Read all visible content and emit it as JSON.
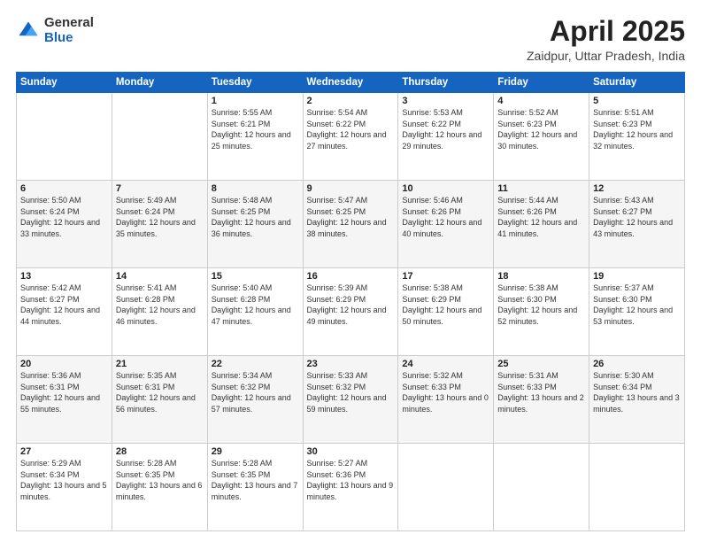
{
  "logo": {
    "general": "General",
    "blue": "Blue"
  },
  "title": "April 2025",
  "location": "Zaidpur, Uttar Pradesh, India",
  "days_of_week": [
    "Sunday",
    "Monday",
    "Tuesday",
    "Wednesday",
    "Thursday",
    "Friday",
    "Saturday"
  ],
  "weeks": [
    [
      {
        "day": "",
        "info": ""
      },
      {
        "day": "",
        "info": ""
      },
      {
        "day": "1",
        "info": "Sunrise: 5:55 AM\nSunset: 6:21 PM\nDaylight: 12 hours and 25 minutes."
      },
      {
        "day": "2",
        "info": "Sunrise: 5:54 AM\nSunset: 6:22 PM\nDaylight: 12 hours and 27 minutes."
      },
      {
        "day": "3",
        "info": "Sunrise: 5:53 AM\nSunset: 6:22 PM\nDaylight: 12 hours and 29 minutes."
      },
      {
        "day": "4",
        "info": "Sunrise: 5:52 AM\nSunset: 6:23 PM\nDaylight: 12 hours and 30 minutes."
      },
      {
        "day": "5",
        "info": "Sunrise: 5:51 AM\nSunset: 6:23 PM\nDaylight: 12 hours and 32 minutes."
      }
    ],
    [
      {
        "day": "6",
        "info": "Sunrise: 5:50 AM\nSunset: 6:24 PM\nDaylight: 12 hours and 33 minutes."
      },
      {
        "day": "7",
        "info": "Sunrise: 5:49 AM\nSunset: 6:24 PM\nDaylight: 12 hours and 35 minutes."
      },
      {
        "day": "8",
        "info": "Sunrise: 5:48 AM\nSunset: 6:25 PM\nDaylight: 12 hours and 36 minutes."
      },
      {
        "day": "9",
        "info": "Sunrise: 5:47 AM\nSunset: 6:25 PM\nDaylight: 12 hours and 38 minutes."
      },
      {
        "day": "10",
        "info": "Sunrise: 5:46 AM\nSunset: 6:26 PM\nDaylight: 12 hours and 40 minutes."
      },
      {
        "day": "11",
        "info": "Sunrise: 5:44 AM\nSunset: 6:26 PM\nDaylight: 12 hours and 41 minutes."
      },
      {
        "day": "12",
        "info": "Sunrise: 5:43 AM\nSunset: 6:27 PM\nDaylight: 12 hours and 43 minutes."
      }
    ],
    [
      {
        "day": "13",
        "info": "Sunrise: 5:42 AM\nSunset: 6:27 PM\nDaylight: 12 hours and 44 minutes."
      },
      {
        "day": "14",
        "info": "Sunrise: 5:41 AM\nSunset: 6:28 PM\nDaylight: 12 hours and 46 minutes."
      },
      {
        "day": "15",
        "info": "Sunrise: 5:40 AM\nSunset: 6:28 PM\nDaylight: 12 hours and 47 minutes."
      },
      {
        "day": "16",
        "info": "Sunrise: 5:39 AM\nSunset: 6:29 PM\nDaylight: 12 hours and 49 minutes."
      },
      {
        "day": "17",
        "info": "Sunrise: 5:38 AM\nSunset: 6:29 PM\nDaylight: 12 hours and 50 minutes."
      },
      {
        "day": "18",
        "info": "Sunrise: 5:38 AM\nSunset: 6:30 PM\nDaylight: 12 hours and 52 minutes."
      },
      {
        "day": "19",
        "info": "Sunrise: 5:37 AM\nSunset: 6:30 PM\nDaylight: 12 hours and 53 minutes."
      }
    ],
    [
      {
        "day": "20",
        "info": "Sunrise: 5:36 AM\nSunset: 6:31 PM\nDaylight: 12 hours and 55 minutes."
      },
      {
        "day": "21",
        "info": "Sunrise: 5:35 AM\nSunset: 6:31 PM\nDaylight: 12 hours and 56 minutes."
      },
      {
        "day": "22",
        "info": "Sunrise: 5:34 AM\nSunset: 6:32 PM\nDaylight: 12 hours and 57 minutes."
      },
      {
        "day": "23",
        "info": "Sunrise: 5:33 AM\nSunset: 6:32 PM\nDaylight: 12 hours and 59 minutes."
      },
      {
        "day": "24",
        "info": "Sunrise: 5:32 AM\nSunset: 6:33 PM\nDaylight: 13 hours and 0 minutes."
      },
      {
        "day": "25",
        "info": "Sunrise: 5:31 AM\nSunset: 6:33 PM\nDaylight: 13 hours and 2 minutes."
      },
      {
        "day": "26",
        "info": "Sunrise: 5:30 AM\nSunset: 6:34 PM\nDaylight: 13 hours and 3 minutes."
      }
    ],
    [
      {
        "day": "27",
        "info": "Sunrise: 5:29 AM\nSunset: 6:34 PM\nDaylight: 13 hours and 5 minutes."
      },
      {
        "day": "28",
        "info": "Sunrise: 5:28 AM\nSunset: 6:35 PM\nDaylight: 13 hours and 6 minutes."
      },
      {
        "day": "29",
        "info": "Sunrise: 5:28 AM\nSunset: 6:35 PM\nDaylight: 13 hours and 7 minutes."
      },
      {
        "day": "30",
        "info": "Sunrise: 5:27 AM\nSunset: 6:36 PM\nDaylight: 13 hours and 9 minutes."
      },
      {
        "day": "",
        "info": ""
      },
      {
        "day": "",
        "info": ""
      },
      {
        "day": "",
        "info": ""
      }
    ]
  ]
}
